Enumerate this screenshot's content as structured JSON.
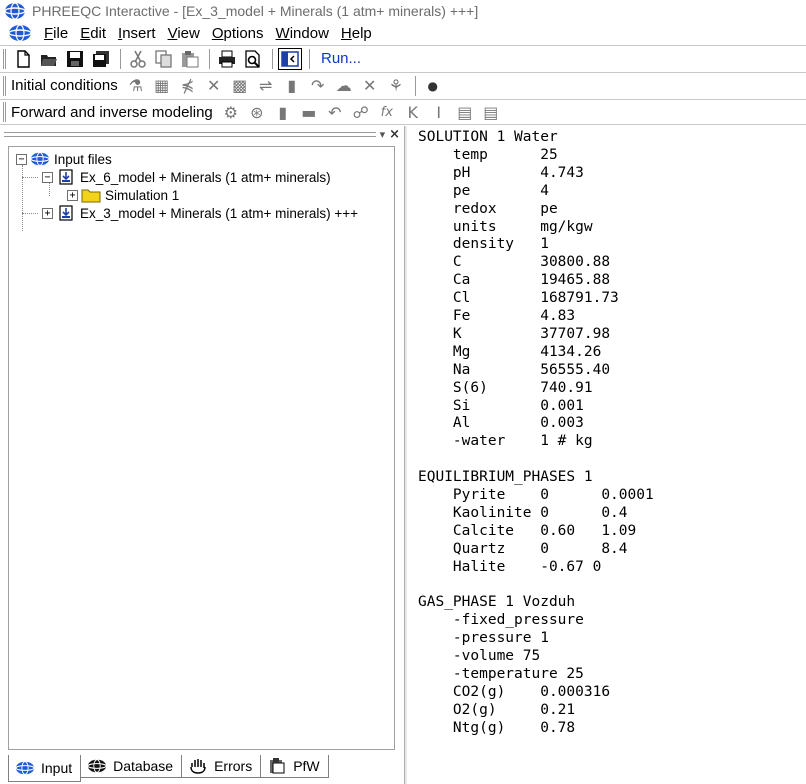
{
  "window": {
    "title": "PHREEQC Interactive - [Ex_3_model + Minerals (1 atm+ minerals) +++]"
  },
  "menu": [
    {
      "label": "File",
      "ul": "F",
      "rest": "ile"
    },
    {
      "label": "Edit",
      "ul": "E",
      "rest": "dit"
    },
    {
      "label": "Insert",
      "ul": "I",
      "rest": "nsert"
    },
    {
      "label": "View",
      "ul": "V",
      "rest": "iew"
    },
    {
      "label": "Options",
      "ul": "O",
      "rest": "ptions"
    },
    {
      "label": "Window",
      "ul": "W",
      "rest": "indow"
    },
    {
      "label": "Help",
      "ul": "H",
      "rest": "elp"
    }
  ],
  "toolbar_main": {
    "run_label": "Run..."
  },
  "toolbar_initial": {
    "label": "Initial conditions"
  },
  "toolbar_forward": {
    "label": "Forward and inverse modeling"
  },
  "tree": {
    "root": "Input files",
    "file1": "Ex_6_model + Minerals (1 atm+ minerals)",
    "sim1": "Simulation 1",
    "file2": "Ex_3_model + Minerals (1 atm+ minerals) +++"
  },
  "tabs": [
    "Input",
    "Database",
    "Errors",
    "PfW"
  ],
  "editor_lines": [
    "SOLUTION 1 Water",
    "    temp      25",
    "    pH        4.743",
    "    pe        4",
    "    redox     pe",
    "    units     mg/kgw",
    "    density   1",
    "    C         30800.88",
    "    Ca        19465.88",
    "    Cl        168791.73",
    "    Fe        4.83",
    "    K         37707.98",
    "    Mg        4134.26",
    "    Na        56555.40",
    "    S(6)      740.91",
    "    Si        0.001",
    "    Al        0.003",
    "    -water    1 # kg",
    "",
    "EQUILIBRIUM_PHASES 1",
    "    Pyrite    0      0.0001",
    "    Kaolinite 0      0.4",
    "    Calcite   0.60   1.09",
    "    Quartz    0      8.4",
    "    Halite    -0.67 0",
    "",
    "GAS_PHASE 1 Vozduh",
    "    -fixed_pressure",
    "    -pressure 1",
    "    -volume 75",
    "    -temperature 25",
    "    CO2(g)    0.000316",
    "    O2(g)     0.21",
    "    Ntg(g)    0.78"
  ],
  "colors": {
    "accent": "#1e5bd6",
    "run": "#0a37c8",
    "folder": "#f2d21b"
  },
  "icons": {
    "toolbar_main": [
      "new-file-icon",
      "open-folder-icon",
      "save-icon",
      "save-all-icon",
      "cut-icon",
      "copy-icon",
      "paste-icon",
      "print-icon",
      "print-preview-icon",
      "toggle-pane-icon"
    ],
    "toolbar_initial": [
      "solution-icon",
      "keyword-icon",
      "equilibrium-icon",
      "exchange-icon",
      "surface-icon",
      "reaction-icon",
      "temperature-icon",
      "mix-icon",
      "gas-icon",
      "kinetics-icon",
      "user-icon",
      "dot-icon"
    ],
    "toolbar_forward": [
      "transport-icon",
      "inverse-icon",
      "thermometer-icon",
      "pressure-icon",
      "undo-kinetic-icon",
      "rates-icon",
      "function-icon",
      "k-icon",
      "i-icon",
      "table-icon",
      "grid-icon"
    ]
  }
}
